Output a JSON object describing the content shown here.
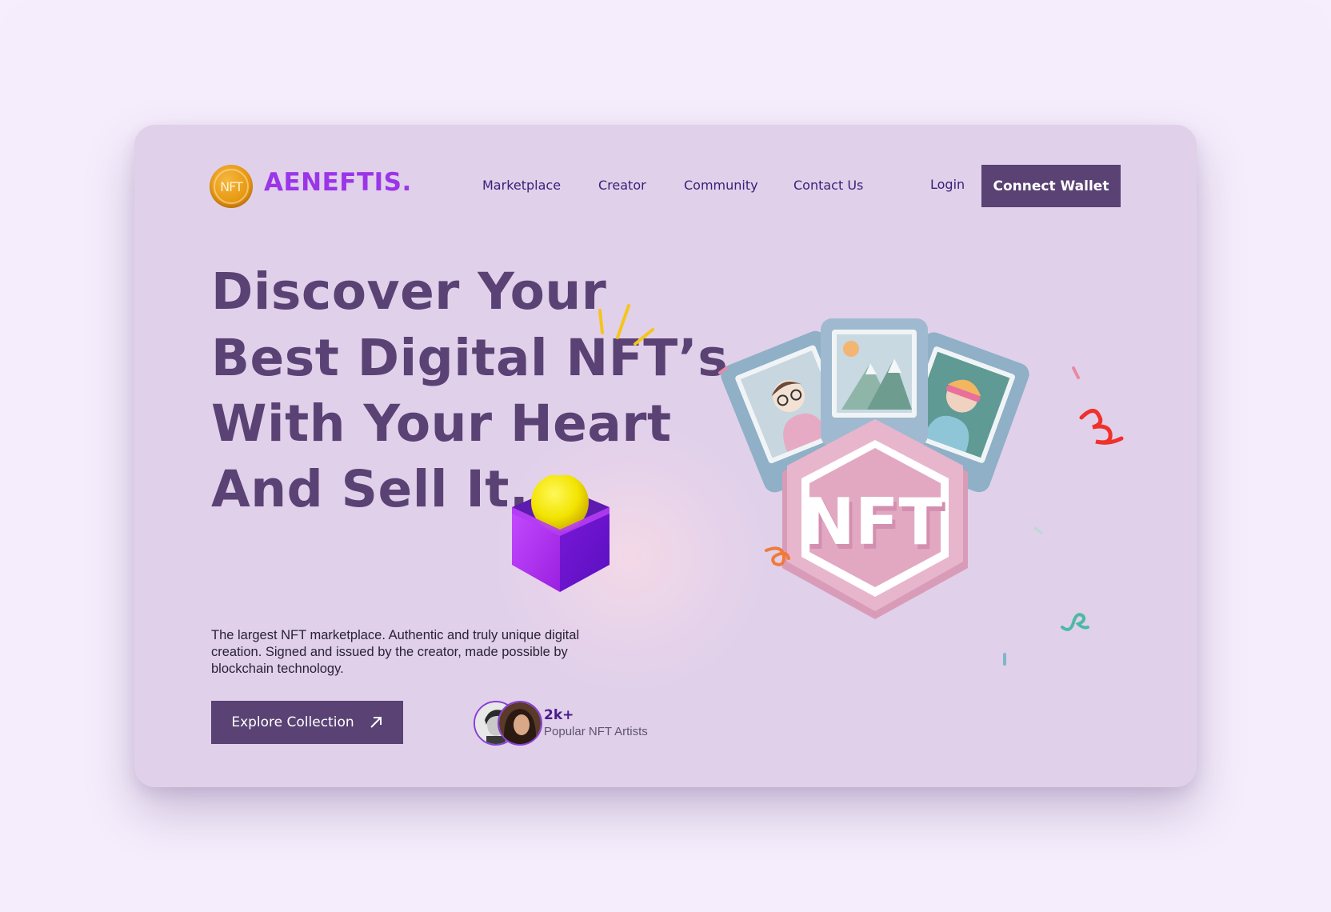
{
  "brand": {
    "name": "AENEFTIS.",
    "logo_text": "NFT",
    "logo_icon": "nft-coin-icon"
  },
  "nav": {
    "items": [
      {
        "label": "Marketplace"
      },
      {
        "label": "Creator"
      },
      {
        "label": "Community"
      },
      {
        "label": "Contact Us"
      }
    ],
    "login_label": "Login",
    "connect_wallet_label": "Connect Wallet"
  },
  "hero": {
    "headline_lines": [
      "Discover Your",
      "Best Digital NFT’s",
      "With Your Heart",
      "And Sell It."
    ],
    "description": "The largest NFT marketplace. Authentic and truly unique digital creation. Signed and issued by the creator, made possible by blockchain technology.",
    "explore_label": "Explore Collection",
    "explore_icon": "arrow-up-right-icon",
    "artists_count": "2k+",
    "artists_label": "Popular NFT Artists",
    "illustration_badge_text": "NFT"
  },
  "colors": {
    "page_bg": "#f5edfc",
    "card_bg": "#e0d0ea",
    "primary": "#5a4274",
    "brand_purple": "#9b35e8",
    "nav_text": "#3d2078",
    "coin_gold": "#e89a14"
  }
}
